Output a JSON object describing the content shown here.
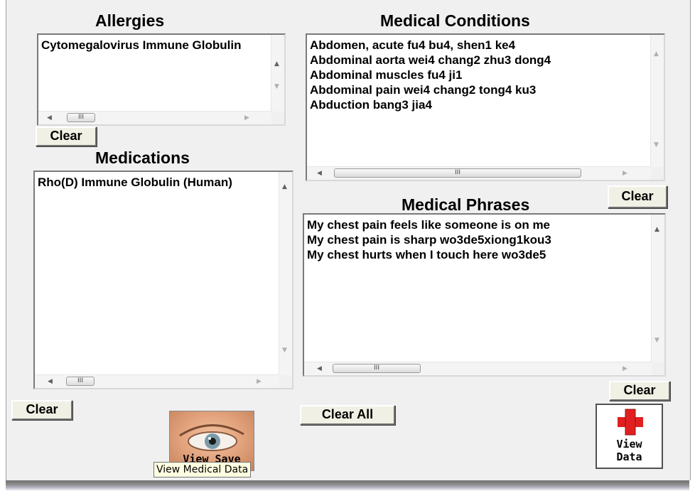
{
  "allergies": {
    "title": "Allergies",
    "items": [
      "Cytomegalovirus Immune Globulin"
    ],
    "clear_label": "Clear"
  },
  "medications": {
    "title": "Medications",
    "items": [
      "Rho(D) Immune Globulin (Human)"
    ],
    "clear_label": "Clear"
  },
  "conditions": {
    "title": "Medical Conditions",
    "items": [
      "Abdomen, acute fu4 bu4,  shen1 ke4",
      "Abdominal aorta wei4 chang2 zhu3 dong4",
      "Abdominal muscles fu4 ji1",
      "Abdominal pain wei4 chang2 tong4 ku3",
      "Abduction bang3 jia4"
    ],
    "clear_label": "Clear"
  },
  "phrases": {
    "title": "Medical Phrases",
    "items": [
      "My chest pain feels like someone is on me",
      "My chest pain is sharp wo3de5xiong1kou3",
      "My chest hurts when I touch here wo3de5"
    ],
    "clear_label": "Clear"
  },
  "clear_all_label": "Clear All",
  "view_save": {
    "label": "View Save",
    "icon": "eye-icon"
  },
  "view_data": {
    "line1": "View",
    "line2": "Data",
    "icon": "red-cross-icon",
    "accent": "#e02020"
  },
  "tooltip": "View Medical Data",
  "scroll_thumb_glyph": "III"
}
